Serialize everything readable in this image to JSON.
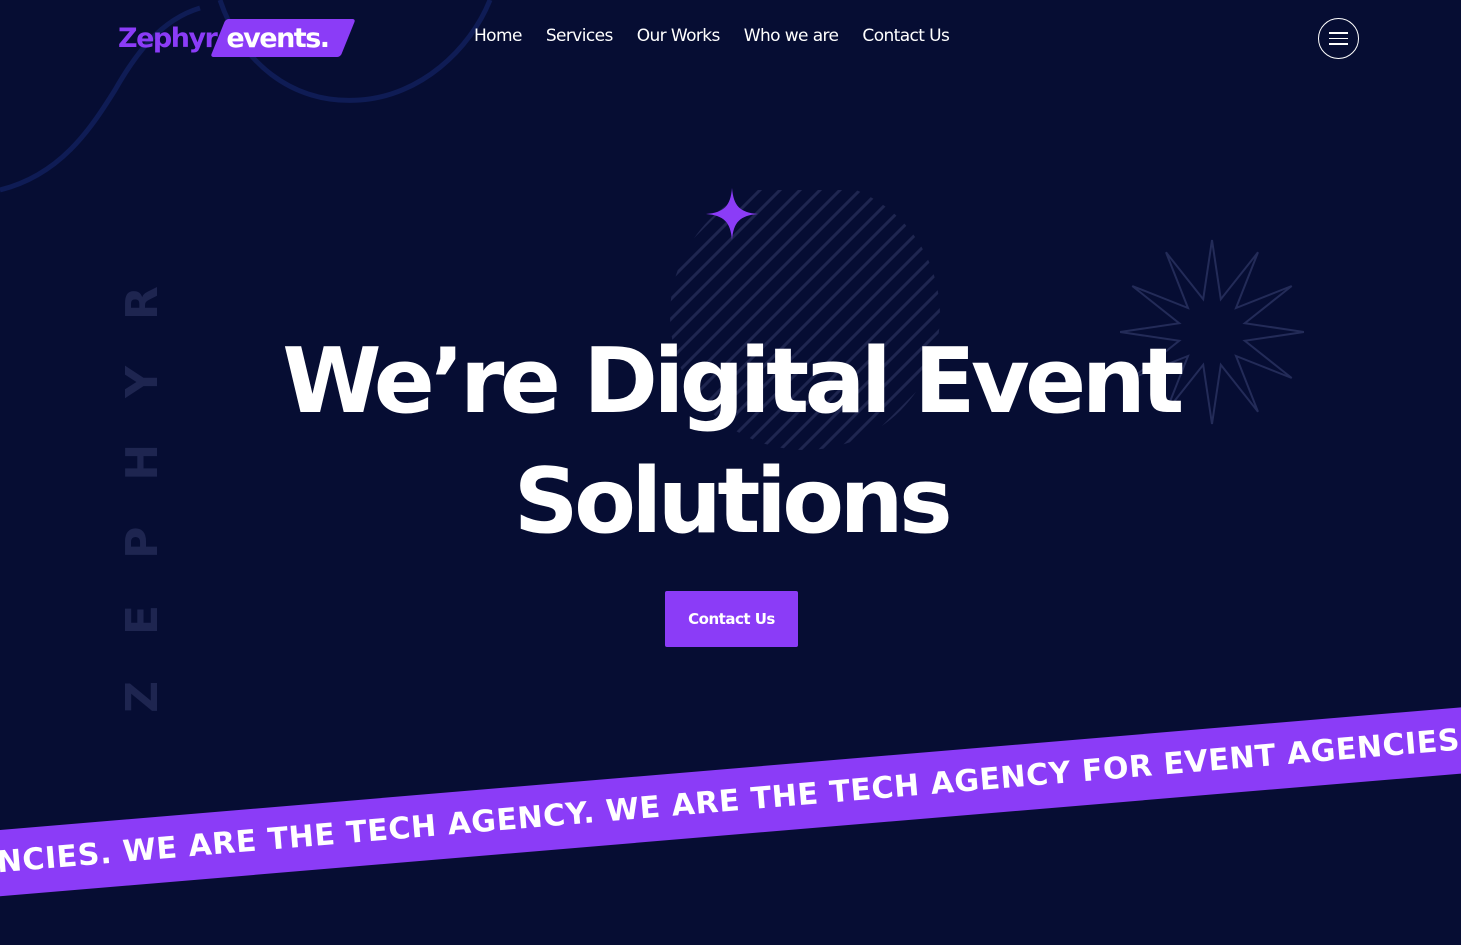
{
  "header": {
    "logo": {
      "word": "Zephyr",
      "badge": "events."
    },
    "nav": [
      {
        "label": "Home"
      },
      {
        "label": "Services"
      },
      {
        "label": "Our Works"
      },
      {
        "label": "Who we are"
      },
      {
        "label": "Contact Us"
      }
    ],
    "menu_icon": "hamburger-menu-icon"
  },
  "side_brand": "ZEPHYR",
  "hero": {
    "title_line1": "We’re Digital Event",
    "title_line2": "Solutions",
    "cta_label": "Contact Us"
  },
  "marquee": {
    "text": "GENCIES. WE ARE THE TECH AGENCY. WE ARE THE TECH AGENCY FOR EVENT AGENCIES."
  },
  "icons": {
    "sparkle": "sparkle-star-icon",
    "starburst": "starburst-outline-icon",
    "sphere": "striped-sphere-decoration"
  },
  "colors": {
    "background": "#060d33",
    "accent": "#8b3cf7",
    "text": "#ffffff",
    "side_brand": "#1e2550"
  }
}
